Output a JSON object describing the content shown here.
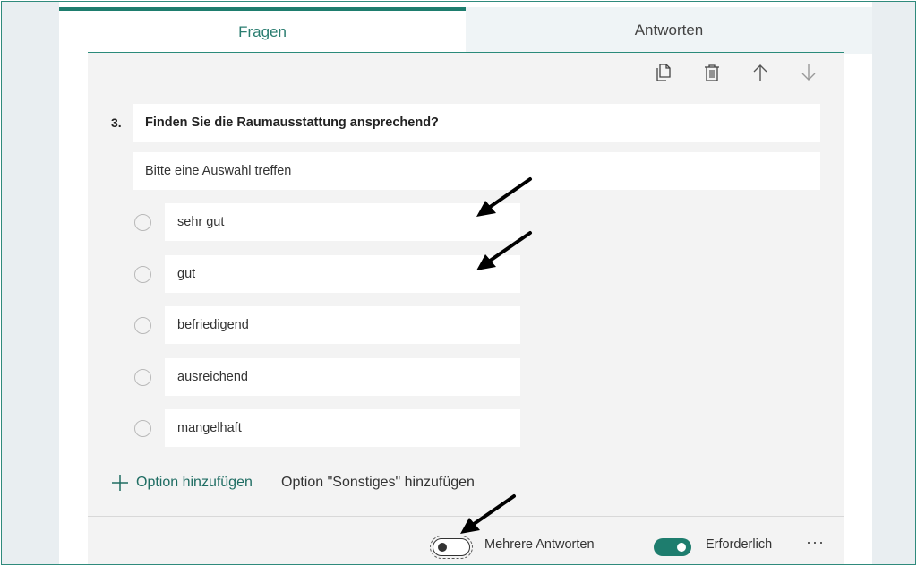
{
  "tabs": [
    {
      "label": "Fragen",
      "active": true
    },
    {
      "label": "Antworten",
      "active": false
    }
  ],
  "toolbar": {
    "icons": [
      "copy-icon",
      "trash-icon",
      "arrow-up-icon",
      "arrow-down-icon"
    ]
  },
  "question": {
    "number": "3.",
    "title": "Finden Sie die Raumausstattung ansprechend?",
    "subtitle": "Bitte eine Auswahl treffen",
    "options": [
      "sehr gut",
      "gut",
      "befriedigend",
      "ausreichend",
      "mangelhaft"
    ]
  },
  "actions": {
    "add_option": "Option hinzufügen",
    "add_other": "Option \"Sonstiges\" hinzufügen"
  },
  "footer": {
    "multiple_answers_label": "Mehrere Antworten",
    "multiple_answers_on": false,
    "required_label": "Erforderlich",
    "required_on": true,
    "more": "···"
  },
  "colors": {
    "accent": "#1e7d6e",
    "panel": "#f3f3f3",
    "border": "#2f8a7c"
  }
}
